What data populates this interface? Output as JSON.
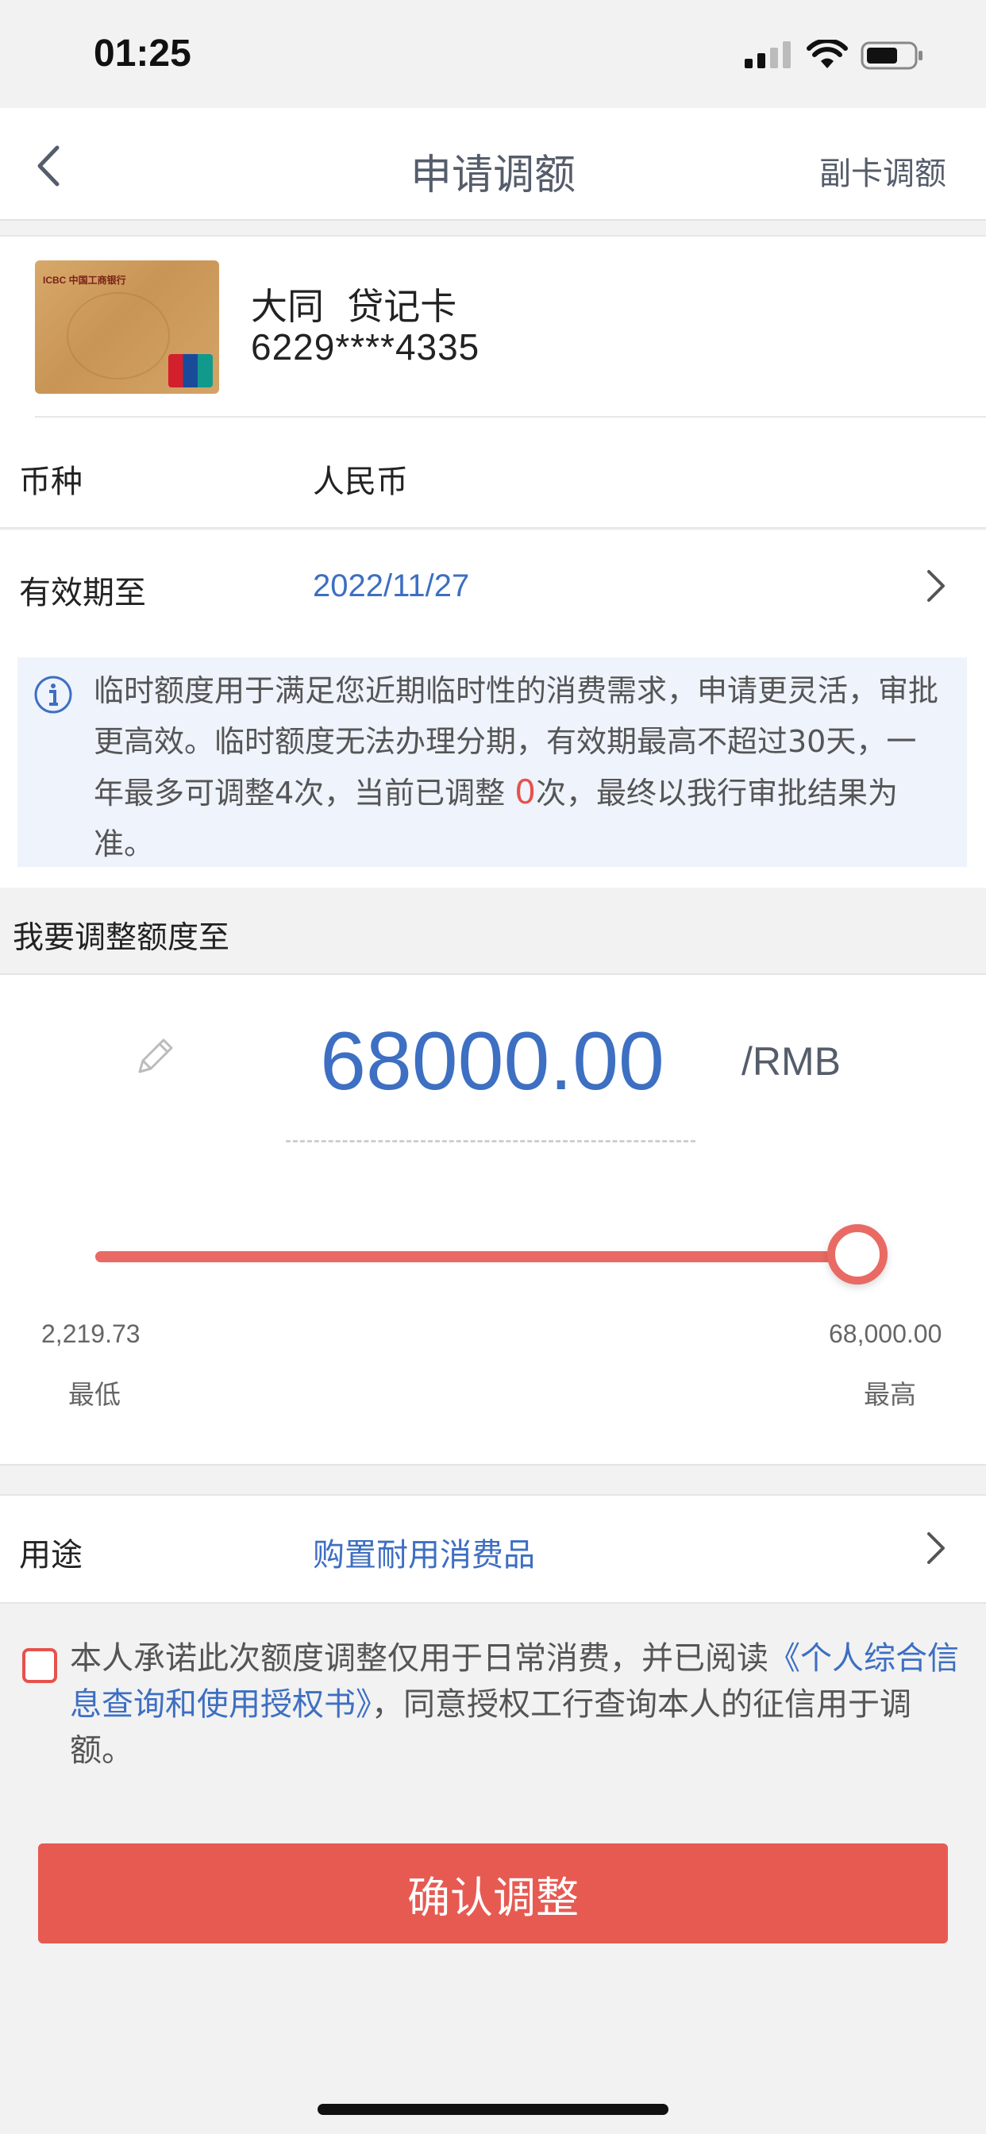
{
  "status_bar": {
    "time": "01:25"
  },
  "nav": {
    "title": "申请调额",
    "right_link": "副卡调额"
  },
  "card": {
    "name": "大同  贷记卡",
    "number": "6229****4335",
    "image_text": "ICBC 中国工商银行"
  },
  "currency": {
    "label": "币种",
    "value": "人民币"
  },
  "expiry": {
    "label": "有效期至",
    "value": "2022/11/27"
  },
  "info": {
    "text_before": "临时额度用于满足您近期临时性的消费需求，申请更灵活，审批更高效。临时额度无法办理分期，有效期最高不超过30天，一年最多可调整4次，当前已调整 ",
    "adjusted_count": "0",
    "text_after": "次，最终以我行审批结果为准。"
  },
  "adjust_header": "我要调整额度至",
  "amount": {
    "value": "68000.00",
    "unit": "/RMB"
  },
  "slider": {
    "min_value": "2,219.73",
    "max_value": "68,000.00",
    "min_label": "最低",
    "max_label": "最高",
    "fraction": 1.0
  },
  "purpose": {
    "label": "用途",
    "value": "购置耐用消费品"
  },
  "agreement": {
    "text_before": "本人承诺此次额度调整仅用于日常消费，并已阅读",
    "link": "《个人综合信息查询和使用授权书》",
    "text_after": "，同意授权工行查询本人的征信用于调额。"
  },
  "confirm_button": "确认调整",
  "colors": {
    "accent_red": "#e65a52",
    "link_blue": "#3d6fc2",
    "info_bg": "#eef3fc"
  }
}
